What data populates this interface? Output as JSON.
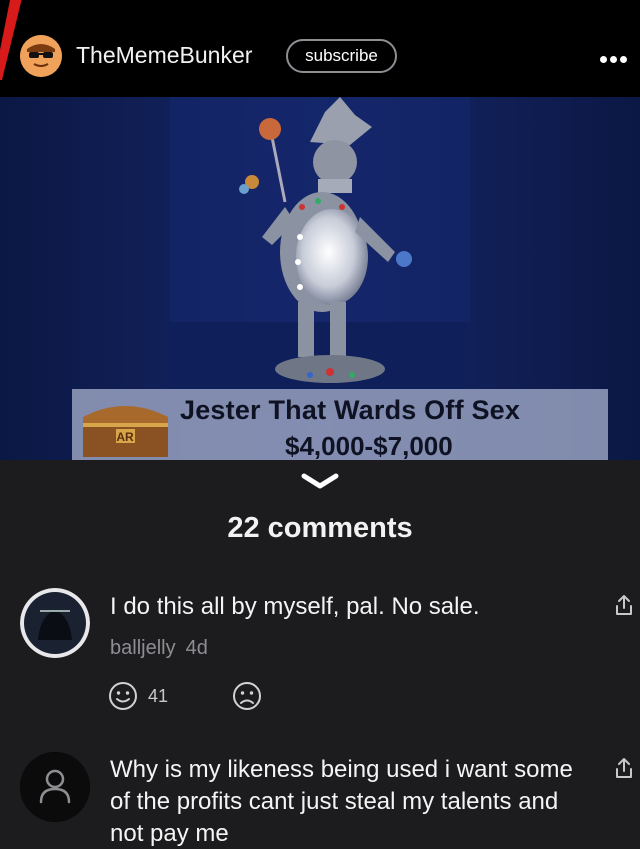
{
  "header": {
    "channel_name": "TheMemeBunker",
    "subscribe_label": "subscribe",
    "more_icon": "more-dots-icon"
  },
  "post_image": {
    "caption_title": "Jester That Wards Off Sex",
    "caption_price": "$4,000-$7,000",
    "badge_text": "AR"
  },
  "comments_section": {
    "count_label": "22 comments",
    "collapse_icon": "chevron-down-icon"
  },
  "comments": [
    {
      "text": "I do this all by myself, pal. No sale.",
      "author": "balljelly",
      "time": "4d",
      "like_count": "41",
      "like_icon": "smile-icon",
      "dislike_icon": "frown-icon",
      "share_icon": "share-icon"
    },
    {
      "text": "Why is my likeness being used i want some of the profits cant just steal my talents and not pay me",
      "share_icon": "share-icon",
      "avatar_icon": "default-user-icon"
    }
  ],
  "colors": {
    "background": "#1c1c1e",
    "header_bg": "#000000",
    "meta_gray": "#8e8e93",
    "image_bg": "#0c1a4a"
  }
}
